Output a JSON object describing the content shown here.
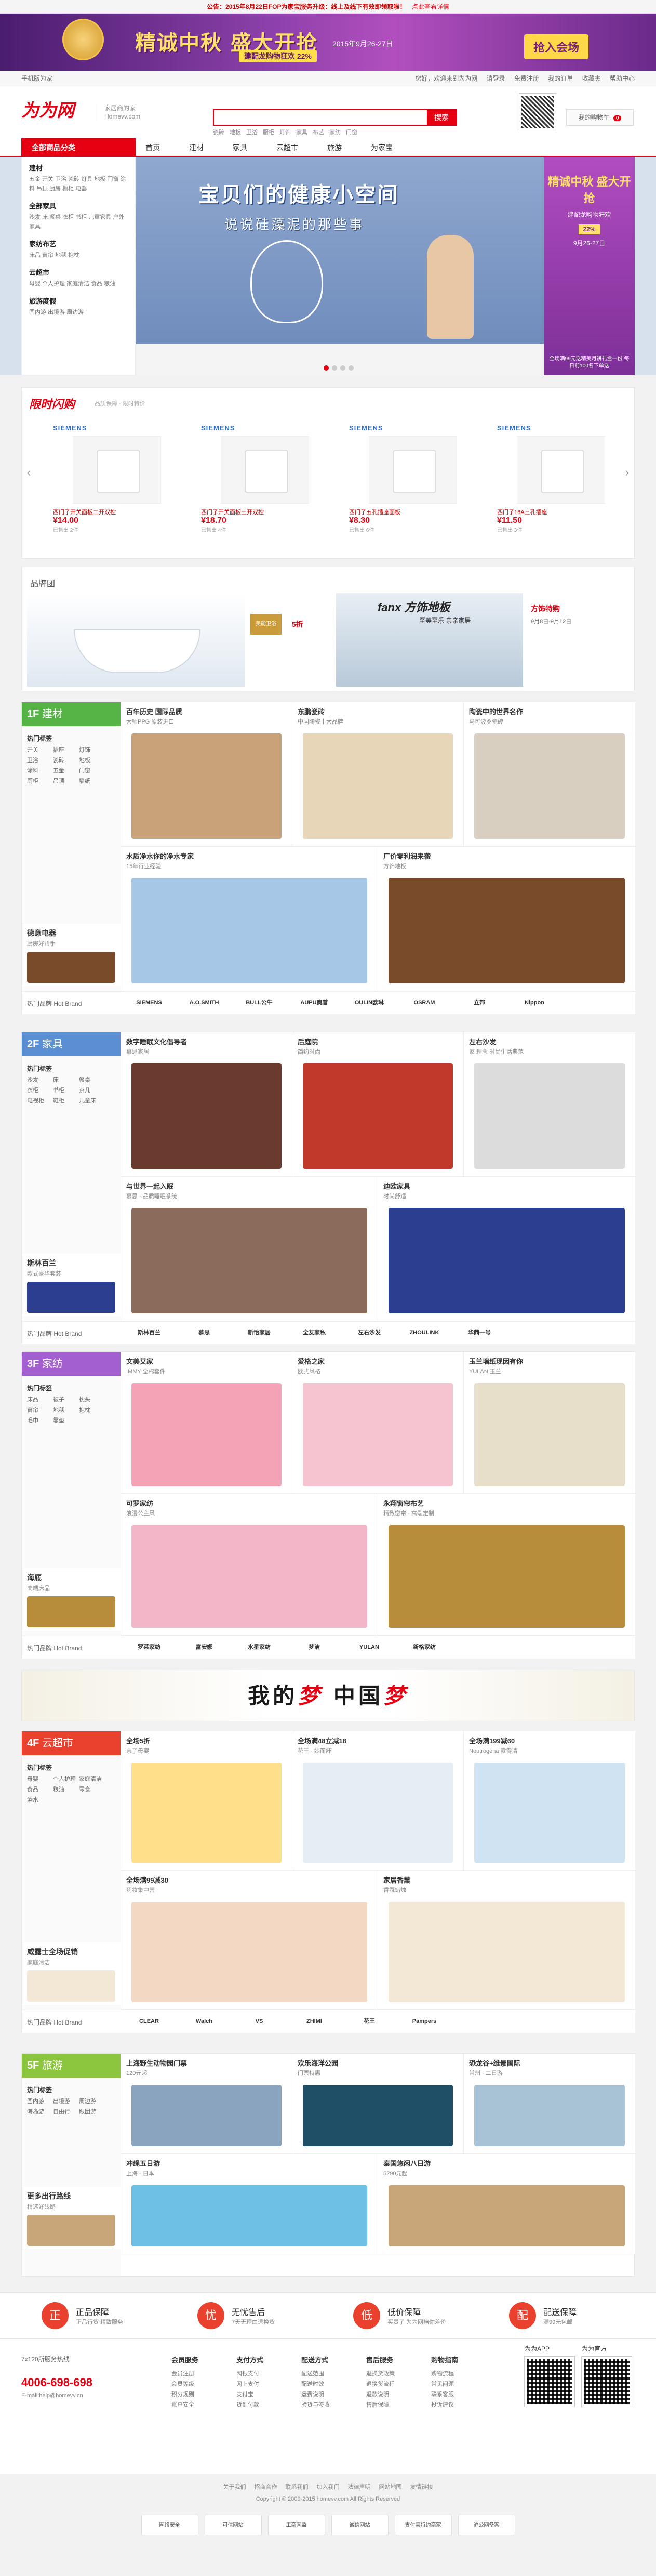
{
  "notice": {
    "text": "公告：2015年8月22日FOP为家宝服务升级：线上及线下有效即领取啦！",
    "link": "点此查看详情"
  },
  "banner": {
    "title": "精诚中秋 盛大开抢",
    "subtitle": "建配龙购物狂欢 22%",
    "date": "2015年9月26-27日",
    "cta": "抢入会场"
  },
  "topbar": {
    "left": "手机版为家",
    "right": [
      "您好，欢迎来到为为网",
      "请登录",
      "免费注册",
      "我的订单",
      "收藏夹",
      "帮助中心"
    ]
  },
  "header": {
    "logo": "为为网",
    "slogan_1": "家居商的家",
    "slogan_2": "Homevv.com",
    "search_placeholder": "",
    "search_btn": "搜索",
    "hot_words": [
      "瓷砖",
      "地板",
      "卫浴",
      "厨柜",
      "灯饰",
      "家具",
      "布艺",
      "家纺",
      "门窗"
    ],
    "cart": "我的购物车",
    "cart_count": "0"
  },
  "nav": {
    "category": "全部商品分类",
    "items": [
      "首页",
      "建材",
      "家具",
      "云超市",
      "旅游",
      "为家宝"
    ]
  },
  "sidebar": [
    {
      "title": "建材",
      "links": "五金 开关 卫浴 瓷砖 灯具 地板 门窗 涂料 吊顶 厨房 橱柜 电器"
    },
    {
      "title": "全部家具",
      "links": "沙发 床 餐桌 衣柜 书柜 儿童家具 户外家具"
    },
    {
      "title": "家纺布艺",
      "links": "床品 窗帘 地毯 抱枕"
    },
    {
      "title": "云超市",
      "links": "母婴 个人护理 家庭清洁 食品 粮油"
    },
    {
      "title": "旅游度假",
      "links": "国内游 出境游 周边游"
    }
  ],
  "hero": {
    "title": "宝贝们的健康小空间",
    "sub": "说说硅藻泥的那些事",
    "ad_title": "精诚中秋 盛大开抢",
    "ad_sub": "建配龙购物狂欢",
    "ad_pct": "22%",
    "ad_date": "9月26-27日",
    "ad_note": "全场满99元送精美月饼礼盒一份 每日前100名下单送"
  },
  "flash": {
    "title": "限时闪购",
    "subtitle": "品质保障 · 限时特价",
    "products": [
      {
        "brand": "SIEMENS",
        "name": "西门子开关面板二开双控",
        "price": "14.00",
        "meta": "已售出 2件"
      },
      {
        "brand": "SIEMENS",
        "name": "西门子开关面板三开双控",
        "price": "18.70",
        "meta": "已售出 4件"
      },
      {
        "brand": "SIEMENS",
        "name": "西门子五孔插座面板",
        "price": "8.30",
        "meta": "已售出 6件"
      },
      {
        "brand": "SIEMENS",
        "name": "西门子16A三孔插座",
        "price": "11.50",
        "meta": "已售出 3件"
      }
    ]
  },
  "brandwall": {
    "title": "品牌团",
    "b1": "美能卫浴",
    "b1_off": "5折",
    "b2": "fanx 方饰地板",
    "b2_sub": "至美至乐 亲亲家居",
    "b3": "方饰特购",
    "b3_date": "9月8日-9月12日"
  },
  "floors": [
    {
      "num": "1F",
      "name": "建材",
      "color": "#56b447",
      "hot": [
        "开关",
        "插座",
        "灯饰",
        "卫浴",
        "瓷砖",
        "地板",
        "涂料",
        "五金",
        "门窗",
        "厨柜",
        "吊顶",
        "墙纸"
      ],
      "promo_t": "德意电器",
      "promo_s": "厨房好帮手",
      "cells": [
        {
          "t": "百年历史 国际品质",
          "s": "大师PPG 原装进口"
        },
        {
          "t": "东鹏瓷砖",
          "s": "中国陶瓷十大品牌"
        },
        {
          "t": "陶瓷中的世界名作",
          "s": "马可波罗瓷砖"
        },
        {
          "t": "水质净水你的净水专家",
          "s": "15年行业经验"
        },
        {
          "t": "厂价零利润来袭",
          "s": "方饰地板"
        }
      ],
      "brands": [
        "SIEMENS",
        "A.O.SMITH",
        "BULL公牛",
        "AUPU奥普",
        "OULIN欧琳",
        "OSRAM",
        "立邦",
        "Nippon"
      ]
    },
    {
      "num": "2F",
      "name": "家具",
      "color": "#5b8fd3",
      "hot": [
        "沙发",
        "床",
        "餐桌",
        "衣柜",
        "书柜",
        "茶几",
        "电视柜",
        "鞋柜",
        "儿童床"
      ],
      "promo_t": "斯林百兰",
      "promo_s": "欧式豪华套装",
      "cells": [
        {
          "t": "数字睡眠文化倡导者",
          "s": "慕思家居"
        },
        {
          "t": "后庭院",
          "s": "简约时尚"
        },
        {
          "t": "左右沙发",
          "s": "家 理念 时尚生活典范"
        },
        {
          "t": "与世界一起入眠",
          "s": "慕思 · 品质睡眠系统"
        },
        {
          "t": "迪欧家具",
          "s": "时尚舒适"
        }
      ],
      "brands": [
        "斯林百兰",
        "慕思",
        "新怡家居",
        "全友家私",
        "左右沙发",
        "ZHOULINK",
        "华鼎一号"
      ]
    },
    {
      "num": "3F",
      "name": "家纺",
      "color": "#a35fd0",
      "hot": [
        "床品",
        "被子",
        "枕头",
        "窗帘",
        "地毯",
        "抱枕",
        "毛巾",
        "靠垫"
      ],
      "promo_t": "海底",
      "promo_s": "高端床品",
      "cells": [
        {
          "t": "文美艾家",
          "s": "IMMY 全棉套件"
        },
        {
          "t": "爱格之家",
          "s": "欧式风格"
        },
        {
          "t": "玉兰墙纸现因有你",
          "s": "YULAN 玉兰"
        },
        {
          "t": "可罗家纺",
          "s": "浪漫公主风"
        },
        {
          "t": "永翔窗帘布艺",
          "s": "精致窗帘 · 高端定制"
        }
      ],
      "brands": [
        "罗莱家纺",
        "富安娜",
        "水星家纺",
        "梦洁",
        "YULAN",
        "新格家纺"
      ]
    },
    {
      "num": "4F",
      "name": "云超市",
      "color": "#e9412e",
      "hot": [
        "母婴",
        "个人护理",
        "家庭清洁",
        "食品",
        "粮油",
        "零食",
        "酒水"
      ],
      "promo_t": "威露士全场促销",
      "promo_s": "家庭清洁",
      "cells": [
        {
          "t": "全场5折",
          "s": "亲子母婴"
        },
        {
          "t": "全场满48立减18",
          "s": "花王 · 妙而舒"
        },
        {
          "t": "全场满199减60",
          "s": "Neutrogena 露得清"
        },
        {
          "t": "全场满99减30",
          "s": "药妆集中营"
        },
        {
          "t": "家居香薰",
          "s": "香氛蜡烛"
        }
      ],
      "brands": [
        "CLEAR",
        "Walch",
        "VS",
        "ZHIMI",
        "花王",
        "Pampers"
      ]
    },
    {
      "num": "5F",
      "name": "旅游",
      "color": "#8cc63f",
      "hot": [
        "国内游",
        "出境游",
        "周边游",
        "海岛游",
        "自由行",
        "跟团游"
      ],
      "promo_t": "更多出行路线",
      "promo_s": "精选好线路",
      "cells": [
        {
          "t": "上海野生动物园门票",
          "s": "120元起"
        },
        {
          "t": "欢乐海洋公园",
          "s": "门票特惠"
        },
        {
          "t": "恐龙谷+维景国际",
          "s": "常州 · 二日游"
        },
        {
          "t": "冲绳五日游",
          "s": "上海 · 日本"
        },
        {
          "t": "泰国悠闲八日游",
          "s": "5290元起"
        }
      ],
      "brands": []
    }
  ],
  "dream": {
    "a": "我的",
    "b": "梦",
    "c": "中国",
    "d": "梦"
  },
  "service": [
    {
      "icon": "正",
      "t": "正品保障",
      "s": "正品行货 精致服务"
    },
    {
      "icon": "忧",
      "t": "无忧售后",
      "s": "7天无理由退换货"
    },
    {
      "icon": "低",
      "t": "低价保障",
      "s": "买贵了 为为网赔你差价"
    },
    {
      "icon": "配",
      "t": "配送保障",
      "s": "满99元包邮"
    }
  ],
  "footer": {
    "hot_title": "7x120所服务热线",
    "phone": "4006-698-698",
    "email": "E-mail:help@homevv.cn",
    "cols": [
      {
        "t": "会员服务",
        "l": [
          "会员注册",
          "会员等级",
          "积分规则",
          "账户安全"
        ]
      },
      {
        "t": "支付方式",
        "l": [
          "网银支付",
          "网上支付",
          "支付宝",
          "货到付款"
        ]
      },
      {
        "t": "配送方式",
        "l": [
          "配送范围",
          "配送时效",
          "运费说明",
          "验货与签收"
        ]
      },
      {
        "t": "售后服务",
        "l": [
          "退换货政策",
          "退换货流程",
          "退款说明",
          "售后保障"
        ]
      },
      {
        "t": "购物指南",
        "l": [
          "购物流程",
          "常见问题",
          "联系客服",
          "投诉建议"
        ]
      }
    ],
    "qr1": "为为APP",
    "qr2": "为为官方"
  },
  "bottom": {
    "links": [
      "关于我们",
      "招商合作",
      "联系我们",
      "加入我们",
      "法律声明",
      "网站地图",
      "友情链接"
    ],
    "cp": "Copyright © 2009-2015 homevv.com All Rights Reserved",
    "badges": [
      "网络安全",
      "可信网站",
      "工商网监",
      "诚信网站",
      "支付宝特约商家",
      "沪公网备案"
    ]
  }
}
